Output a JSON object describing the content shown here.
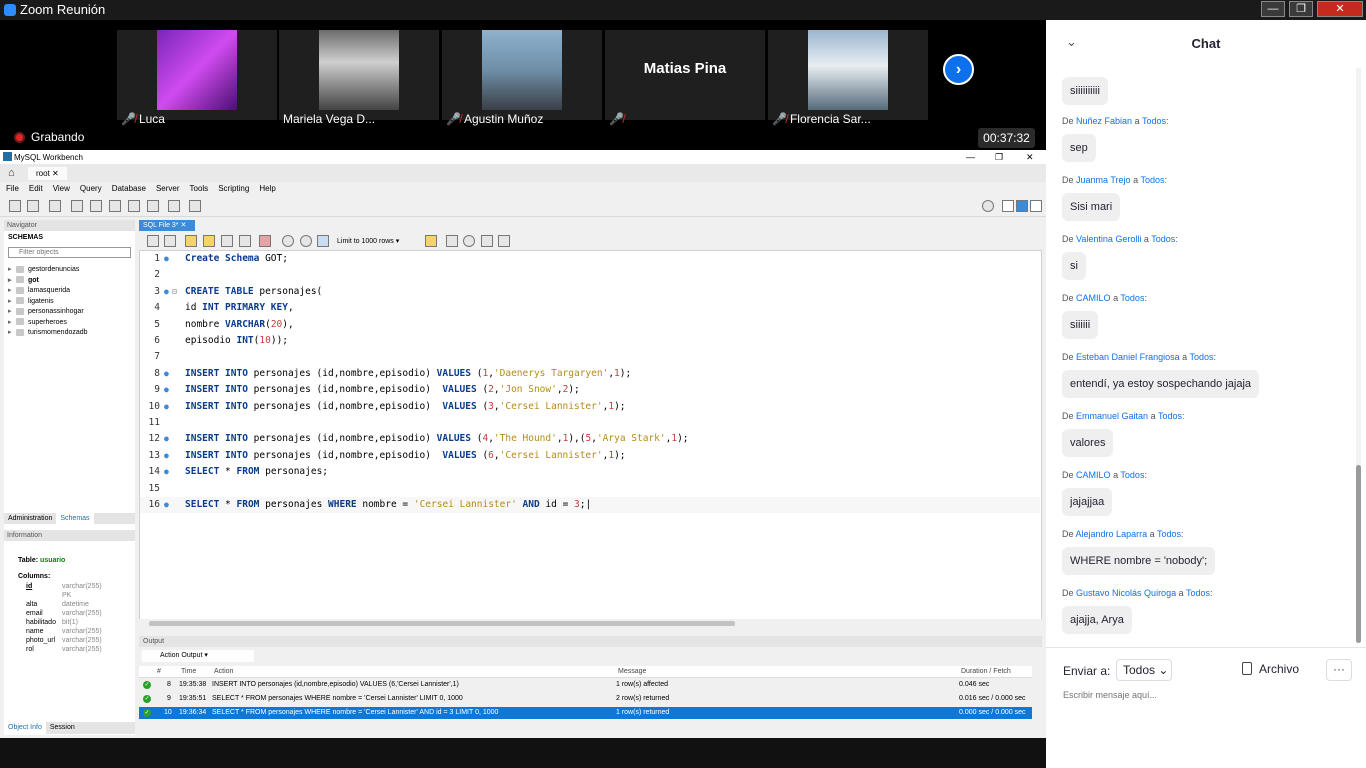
{
  "zoom": {
    "window_title": "Zoom Reunión",
    "window_controls": {
      "minimize": "—",
      "maximize": "❐",
      "close": "✕"
    },
    "participants": [
      {
        "name": "Luca",
        "muted": true
      },
      {
        "name": "Mariela Vega D...",
        "muted": false
      },
      {
        "name": "Agustin Muñoz",
        "muted": true
      },
      {
        "name": "Matias Pina",
        "muted": true
      },
      {
        "name": "Florencia Sar...",
        "muted": true
      }
    ],
    "recording_label": "Grabando",
    "timer": "00:37:32",
    "next_icon": "chevron-right-icon"
  },
  "workbench": {
    "title": "MySQL Workbench",
    "connection_tab": "root",
    "menu": [
      "File",
      "Edit",
      "View",
      "Query",
      "Database",
      "Server",
      "Tools",
      "Scripting",
      "Help"
    ],
    "navigator": {
      "header": "Navigator",
      "schemas_header": "SCHEMAS",
      "filter_placeholder": "Filter objects",
      "schemas": [
        "gestordenuncias",
        "got",
        "lamasquerida",
        "ligatenis",
        "personassinhogar",
        "superheroes",
        "turismomendozadb"
      ],
      "active_schema": "got",
      "tabs": [
        "Administration",
        "Schemas"
      ],
      "information_header": "Information",
      "table_label": "Table: ",
      "table_name": "usuario",
      "columns_header": "Columns:",
      "columns": [
        {
          "name": "id",
          "type": "varchar(255)"
        },
        {
          "name": "",
          "type": "PK"
        },
        {
          "name": "alta",
          "type": "datetime"
        },
        {
          "name": "email",
          "type": "varchar(255)"
        },
        {
          "name": "habilitado",
          "type": "bit(1)"
        },
        {
          "name": "name",
          "type": "varchar(255)"
        },
        {
          "name": "photo_url",
          "type": "varchar(255)"
        },
        {
          "name": "rol",
          "type": "varchar(255)"
        }
      ],
      "bottom_tabs": [
        "Object Info",
        "Session"
      ]
    },
    "editor": {
      "tab_label": "SQL File 3*",
      "limit_label": "Limit to 1000 rows",
      "line_numbers": [
        "1",
        "2",
        "3",
        "4",
        "5",
        "6",
        "7",
        "8",
        "9",
        "10",
        "11",
        "12",
        "13",
        "14",
        "15",
        "16"
      ]
    },
    "output": {
      "header": "Output",
      "selector": "Action Output",
      "columns": [
        "#",
        "Time",
        "Action",
        "Message",
        "Duration / Fetch"
      ],
      "rows": [
        {
          "num": "8",
          "time": "19:35:38",
          "action": "INSERT INTO personajes (id,nombre,episodio)  VALUES (6,'Cersei Lannister',1)",
          "message": "1 row(s) affected",
          "duration": "0.046 sec"
        },
        {
          "num": "9",
          "time": "19:35:51",
          "action": "SELECT * FROM personajes WHERE nombre = 'Cersei Lannister' LIMIT 0, 1000",
          "message": "2 row(s) returned",
          "duration": "0.016 sec / 0.000 sec"
        },
        {
          "num": "10",
          "time": "19:36:34",
          "action": "SELECT * FROM personajes WHERE nombre = 'Cersei Lannister' AND id = 3 LIMIT 0, 1000",
          "message": "1 row(s) returned",
          "duration": "0.000 sec / 0.000 sec"
        }
      ]
    }
  },
  "chat": {
    "title": "Chat",
    "messages": [
      {
        "from": "",
        "to": "",
        "text": "siiiiiiiiii"
      },
      {
        "from": "Nuñez Fabian",
        "to": "Todos",
        "text": "sep"
      },
      {
        "from": "Juanma Trejo",
        "to": "Todos",
        "text": "Sisi mari"
      },
      {
        "from": "Valentina Gerolli",
        "to": "Todos",
        "text": "si"
      },
      {
        "from": "CAMILO",
        "to": "Todos",
        "text": "siiiiii"
      },
      {
        "from": "Esteban Daniel Frangiosa",
        "to": "Todos",
        "text": "entendí, ya estoy sospechando jajaja"
      },
      {
        "from": "Emmanuel Gaitan",
        "to": "Todos",
        "text": "valores"
      },
      {
        "from": "CAMILO",
        "to": "Todos",
        "text": "jajajjaa"
      },
      {
        "from": "Alejandro Laparra",
        "to": "Todos",
        "text": "WHERE nombre = 'nobody';"
      },
      {
        "from": "Gustavo Nicolás Quiroga",
        "to": "Todos",
        "text": "ajajja, Arya"
      }
    ],
    "de_label": "De",
    "a_label": "a",
    "send_to_label": "Enviar a:",
    "send_to_value": "Todos",
    "file_label": "Archivo",
    "more_label": "···",
    "input_placeholder": "Escribir mensaje aquí..."
  }
}
